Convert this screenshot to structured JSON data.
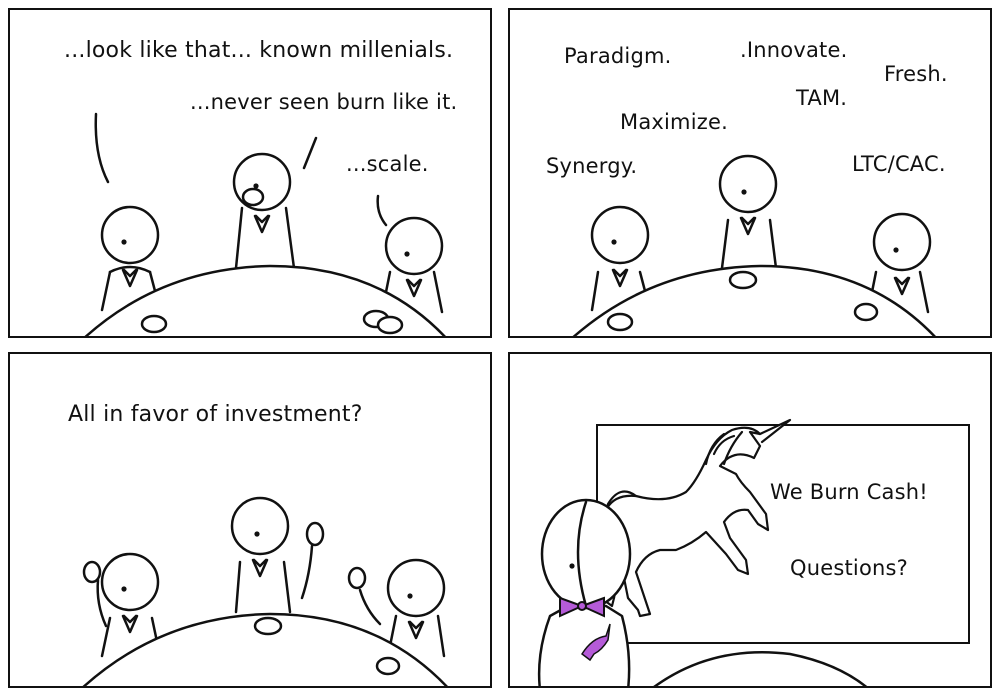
{
  "panel1": {
    "speech": [
      "...look like that... known millenials.",
      "...never seen burn like it.",
      "...scale."
    ]
  },
  "panel2": {
    "buzzwords": [
      "Paradigm.",
      ".Innovate.",
      "Fresh.",
      "TAM.",
      "Maximize.",
      "Synergy.",
      "LTC/CAC."
    ]
  },
  "panel3": {
    "question": "All in favor of investment?"
  },
  "panel4": {
    "slide_title": "We Burn Cash!",
    "slide_question": "Questions?"
  },
  "colors": {
    "ink": "#111111",
    "accent": "#b55bd8",
    "background": "#ffffff"
  }
}
